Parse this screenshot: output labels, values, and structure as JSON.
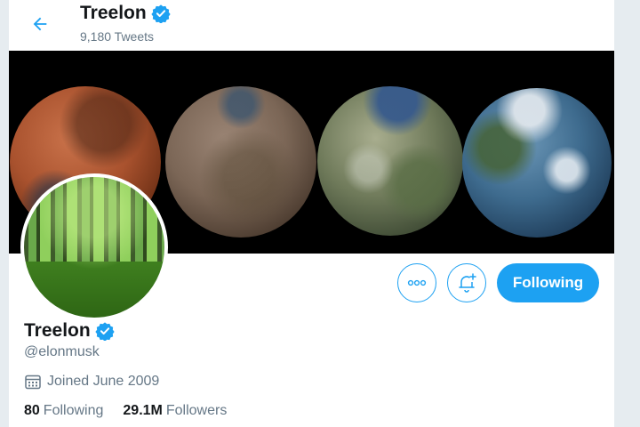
{
  "header": {
    "name": "Treelon",
    "tweet_count": "9,180 Tweets"
  },
  "profile": {
    "name": "Treelon",
    "handle": "@elonmusk",
    "joined": "Joined June 2009",
    "verified": true
  },
  "actions": {
    "following_label": "Following"
  },
  "stats": {
    "following_count": "80",
    "following_label": "Following",
    "followers_count": "29.1M",
    "followers_label": "Followers"
  },
  "icons": {
    "back": "arrow-left-icon",
    "verified": "verified-badge-icon",
    "more": "more-horizontal-icon",
    "notify": "bell-plus-icon",
    "calendar": "calendar-icon"
  },
  "colors": {
    "accent": "#1da1f2",
    "text_primary": "#14171a",
    "text_secondary": "#657786"
  }
}
